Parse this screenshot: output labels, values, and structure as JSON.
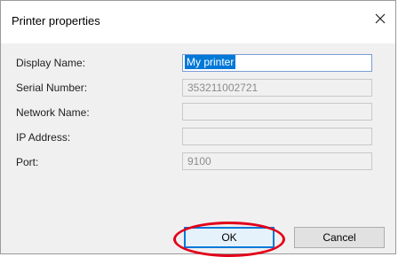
{
  "dialog": {
    "title": "Printer properties",
    "close_glyph": "✕"
  },
  "fields": [
    {
      "label": "Display Name:",
      "value": "My printer",
      "active": true
    },
    {
      "label": "Serial Number:",
      "value": "353211002721",
      "active": false
    },
    {
      "label": "Network Name:",
      "value": "",
      "active": false
    },
    {
      "label": "IP Address:",
      "value": "",
      "active": false
    },
    {
      "label": "Port:",
      "value": "9100",
      "active": false
    }
  ],
  "buttons": {
    "ok_label": "OK",
    "cancel_label": "Cancel"
  },
  "colors": {
    "selection": "#0078d7",
    "annotation": "#e2001a"
  },
  "icons": {
    "close": "close-icon"
  }
}
